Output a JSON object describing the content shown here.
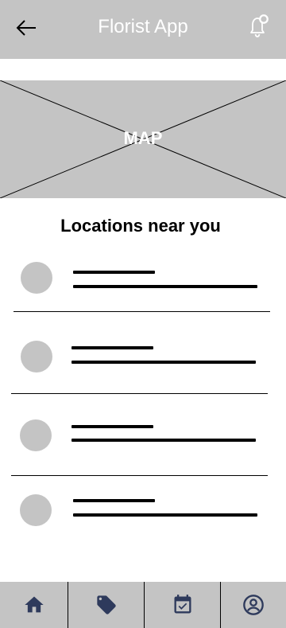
{
  "header": {
    "title": "Florist App",
    "back_icon": "arrow-left-icon",
    "notification_icon": "bell-icon"
  },
  "map": {
    "label": "MAP"
  },
  "locations": {
    "title": "Locations near you",
    "items_count_visible": 4
  },
  "bottom_nav": {
    "items": [
      {
        "icon": "home-icon"
      },
      {
        "icon": "tag-icon"
      },
      {
        "icon": "calendar-check-icon"
      },
      {
        "icon": "account-circle-icon"
      }
    ]
  },
  "colors": {
    "placeholder_gray": "#c4c4c4",
    "nav_icon": "#2e3a5c",
    "text": "#000000",
    "header_text": "#ffffff"
  }
}
